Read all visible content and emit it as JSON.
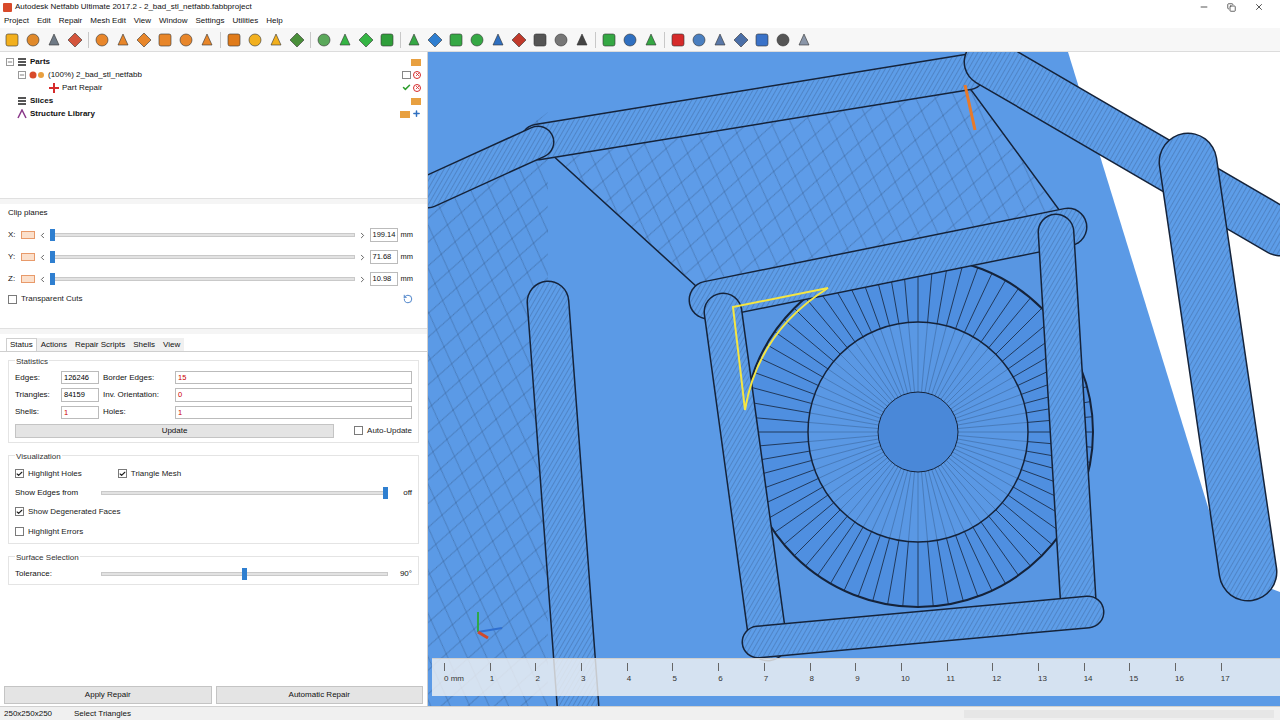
{
  "window": {
    "title": "Autodesk Netfabb Ultimate 2017.2 - 2_bad_stl_netfabb.fabbproject"
  },
  "menu": [
    "Project",
    "Edit",
    "Repair",
    "Mesh Edit",
    "View",
    "Window",
    "Settings",
    "Utilities",
    "Help"
  ],
  "tree": [
    {
      "label": "Parts",
      "kind": "group",
      "expanded": true
    },
    {
      "label": "(100%) 2_bad_stl_netfabb",
      "kind": "part",
      "expanded": true
    },
    {
      "label": "Part Repair",
      "kind": "repair",
      "expanded": false
    },
    {
      "label": "Slices",
      "kind": "group",
      "expanded": false
    },
    {
      "label": "Structure Library",
      "kind": "library",
      "expanded": false
    }
  ],
  "clip_planes": {
    "title": "Clip planes",
    "axes": [
      {
        "label": "X:",
        "value": "199.14",
        "unit": "mm",
        "level": 0
      },
      {
        "label": "Y:",
        "value": "71.68",
        "unit": "mm",
        "level": 0
      },
      {
        "label": "Z:",
        "value": "10.98",
        "unit": "mm",
        "level": 0
      }
    ],
    "transparent_cuts": {
      "label": "Transparent Cuts",
      "checked": false
    }
  },
  "tabs": [
    {
      "label": "Status",
      "selected": true
    },
    {
      "label": "Actions",
      "selected": false
    },
    {
      "label": "Repair Scripts",
      "selected": false
    },
    {
      "label": "Shells",
      "selected": false
    },
    {
      "label": "View",
      "selected": false
    }
  ],
  "statistics": {
    "title": "Statistics",
    "fields": [
      {
        "label": "Edges:",
        "value": "126246",
        "color": "#000000"
      },
      {
        "label": "Border Edges:",
        "value": "15",
        "color": "#cc0000"
      },
      {
        "label": "Triangles:",
        "value": "84159",
        "color": "#000000"
      },
      {
        "label": "Inv. Orientation:",
        "value": "0",
        "color": "#cc0000"
      },
      {
        "label": "Shells:",
        "value": "1",
        "color": "#cc0000"
      },
      {
        "label": "Holes:",
        "value": "1",
        "color": "#cc0000"
      }
    ],
    "update_button": "Update",
    "auto_update": {
      "label": "Auto-Update",
      "checked": false
    }
  },
  "visualization": {
    "title": "Visualization",
    "highlight_holes": {
      "label": "Highlight Holes",
      "checked": true
    },
    "triangle_mesh": {
      "label": "Triangle Mesh",
      "checked": true
    },
    "show_edges": {
      "label": "Show Edges from",
      "level": 1,
      "reading": "off"
    },
    "degenerated_faces": {
      "label": "Show Degenerated Faces",
      "checked": true
    },
    "highlight_errors": {
      "label": "Highlight Errors",
      "checked": false
    }
  },
  "surface_selection": {
    "title": "Surface Selection",
    "tolerance": {
      "label": "Tolerance:",
      "level": 0.5,
      "reading": "90°"
    }
  },
  "buttons": [
    "Apply Repair",
    "Automatic Repair"
  ],
  "ruler": {
    "labels": [
      "0 mm",
      "1",
      "2",
      "3",
      "4",
      "5",
      "6",
      "7",
      "8",
      "9",
      "10",
      "11",
      "12",
      "13",
      "14",
      "15",
      "16",
      "17"
    ]
  },
  "status_bar": {
    "size": "250x250x250",
    "mode": "Select Triangles"
  }
}
